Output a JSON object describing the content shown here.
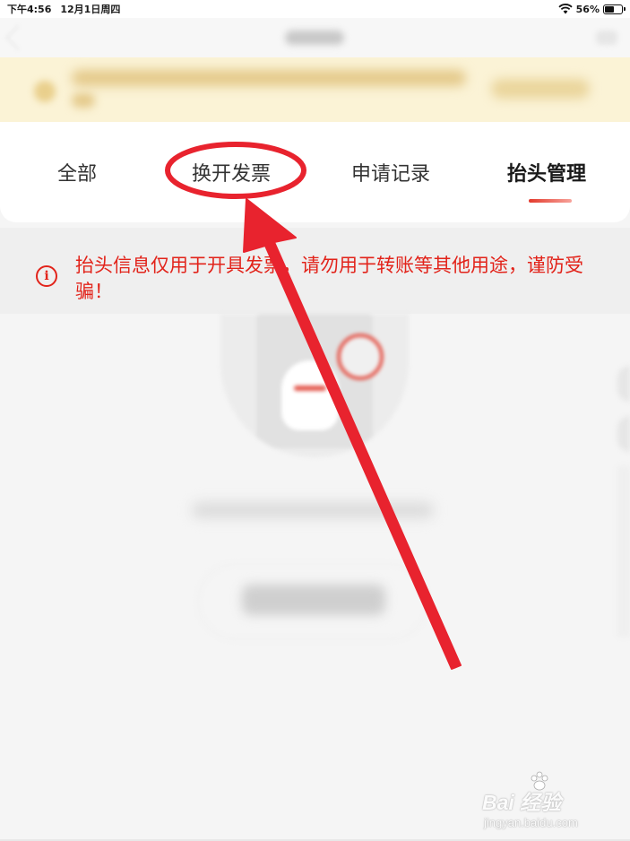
{
  "status_bar": {
    "time": "下午4:56",
    "date": "12月1日周四",
    "battery": "56%",
    "battery_level": 0.56,
    "wifi_icon": "wifi-icon",
    "battery_icon": "battery-icon"
  },
  "tabs": [
    {
      "label": "全部",
      "active": false
    },
    {
      "label": "换开发票",
      "active": false,
      "highlighted": true
    },
    {
      "label": "申请记录",
      "active": false
    },
    {
      "label": "抬头管理",
      "active": true
    }
  ],
  "warning": {
    "icon": "info-icon",
    "text": "抬头信息仅用于开具发票，请勿用于转账等其他用途，谨防受骗！"
  },
  "annotation": {
    "color": "#e8232e",
    "shapes": [
      "circle",
      "arrow"
    ]
  },
  "watermark": {
    "logo": "Bai  经验",
    "url": "jingyan.baidu.com"
  },
  "colors": {
    "accent": "#e2231a",
    "notice_bg": "#fbf3d6"
  }
}
